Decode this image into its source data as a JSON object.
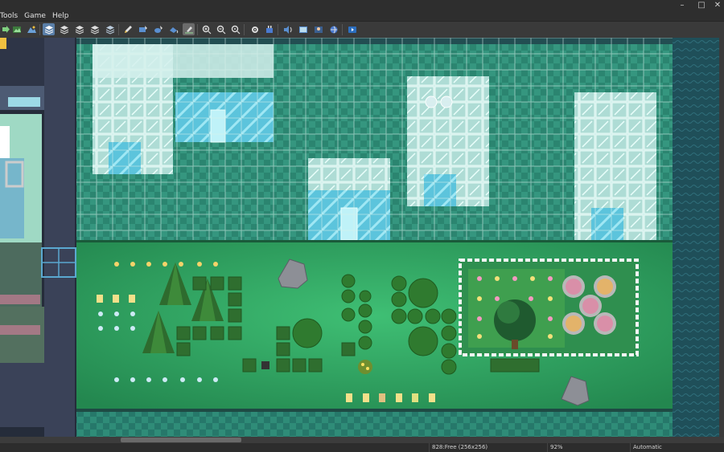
{
  "menu": {
    "items": [
      {
        "label": "Tools"
      },
      {
        "label": "Game"
      },
      {
        "label": "Help"
      }
    ]
  },
  "window_controls": {
    "minimize": "–",
    "maximize": "□",
    "close": "✕"
  },
  "toolbar": {
    "buttons": [
      {
        "icon": "arrow-right-icon",
        "name": "play-arrow-button"
      },
      {
        "icon": "map-mode-icon",
        "name": "map-mode-button"
      },
      {
        "icon": "event-mode-icon",
        "name": "event-mode-button"
      },
      {
        "icon": "layer-1-icon",
        "name": "layer-1-button",
        "active": true
      },
      {
        "icon": "layer-2-icon",
        "name": "layer-2-button"
      },
      {
        "icon": "layer-3-icon",
        "name": "layer-3-button"
      },
      {
        "icon": "layer-4-icon",
        "name": "layer-4-button"
      },
      {
        "icon": "pencil-icon",
        "name": "pencil-tool-button"
      },
      {
        "icon": "rectangle-icon",
        "name": "rectangle-tool-button"
      },
      {
        "icon": "ellipse-icon",
        "name": "ellipse-tool-button"
      },
      {
        "icon": "flood-fill-icon",
        "name": "fill-tool-button"
      },
      {
        "icon": "shadow-pen-icon",
        "name": "shadow-pen-button",
        "active2": true
      },
      {
        "icon": "zoom-in-icon",
        "name": "zoom-in-button"
      },
      {
        "icon": "zoom-out-icon",
        "name": "zoom-out-button"
      },
      {
        "icon": "zoom-actual-icon",
        "name": "zoom-actual-button"
      },
      {
        "icon": "database-icon",
        "name": "database-button"
      },
      {
        "icon": "plugin-icon",
        "name": "plugin-manager-button"
      },
      {
        "icon": "sound-icon",
        "name": "sound-test-button"
      },
      {
        "icon": "event-search-icon",
        "name": "event-search-button"
      },
      {
        "icon": "character-generator-icon",
        "name": "character-generator-button"
      },
      {
        "icon": "resource-manager-icon",
        "name": "resource-manager-button"
      },
      {
        "icon": "playtest-icon",
        "name": "playtest-button"
      }
    ]
  },
  "status": {
    "tile_info": "828:Free (256x256)",
    "zoom": "92%",
    "mode": "Automatic"
  },
  "colors": {
    "floor_teal": "#2f8f7c",
    "glass": "#b9e6e0",
    "grass": "#2fa05a",
    "wall_dark": "#2a3a4e",
    "water": "#1d4d57",
    "toolbar_active": "#5a7fa8"
  }
}
